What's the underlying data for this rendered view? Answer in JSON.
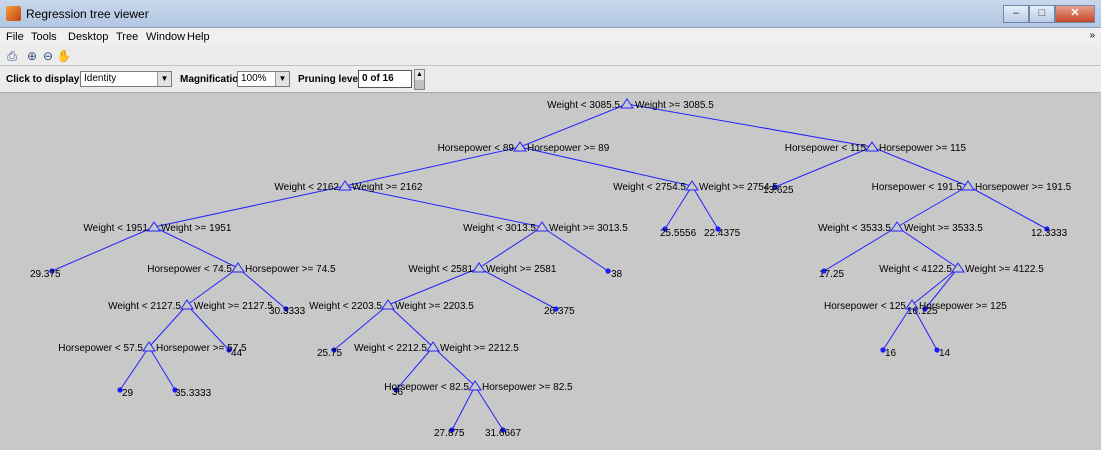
{
  "window": {
    "title": "Regression tree viewer",
    "controls": [
      "minimize",
      "maximize",
      "close"
    ]
  },
  "menu": {
    "items": [
      "File",
      "Tools",
      "Desktop",
      "Tree",
      "Window",
      "Help"
    ],
    "overflow": "»"
  },
  "toolbar": {
    "icons": [
      "print-icon",
      "zoom-in-icon",
      "zoom-out-icon",
      "pan-hand-icon"
    ]
  },
  "controls": {
    "click_label": "Click to display:",
    "click_value": "Identity",
    "magnification_label": "Magnification:",
    "magnification_value": "100%",
    "pruning_label": "Pruning level:",
    "pruning_value": "0 of 16"
  },
  "colors": {
    "tree": "#2222ff",
    "canvas": "#c8c8c8"
  },
  "tree": {
    "splits": [
      {
        "left": "Weight < 3085.5",
        "right": "Weight >= 3085.5"
      },
      {
        "left": "Horsepower < 89",
        "right": "Horsepower >= 89"
      },
      {
        "left": "Horsepower < 115",
        "right": "Horsepower >= 115"
      },
      {
        "left": "Weight < 2162",
        "right": "Weight >= 2162"
      },
      {
        "left": "Weight < 2754.5",
        "right": "Weight >= 2754.5"
      },
      {
        "left": "Horsepower < 191.5",
        "right": "Horsepower >= 191.5"
      },
      {
        "left": "Weight < 1951",
        "right": "Weight >= 1951"
      },
      {
        "left": "Weight < 3013.5",
        "right": "Weight >= 3013.5"
      },
      {
        "left": "Weight < 3533.5",
        "right": "Weight >= 3533.5"
      },
      {
        "left": "Horsepower < 74.5",
        "right": "Horsepower >= 74.5"
      },
      {
        "left": "Weight < 2581",
        "right": "Weight >= 2581"
      },
      {
        "left": "Weight < 4122.5",
        "right": "Weight >= 4122.5"
      },
      {
        "left": "Weight < 2127.5",
        "right": "Weight >= 2127.5"
      },
      {
        "left": "Weight < 2203.5",
        "right": "Weight >= 2203.5"
      },
      {
        "left": "Horsepower < 125",
        "right": "Horsepower >= 125"
      },
      {
        "left": "Horsepower < 57.5",
        "right": "Horsepower >= 57.5"
      },
      {
        "left": "Weight < 2212.5",
        "right": "Weight >= 2212.5"
      },
      {
        "left": "Horsepower < 82.5",
        "right": "Horsepower >= 82.5"
      }
    ],
    "leaves": [
      "13.625",
      "25.5556",
      "22.4375",
      "12.3333",
      "29.375",
      "38",
      "17.25",
      "30.3333",
      "26.375",
      "16.125",
      "44",
      "25.75",
      "16",
      "14",
      "29",
      "35.3333",
      "36",
      "27.875",
      "31.6667"
    ]
  }
}
